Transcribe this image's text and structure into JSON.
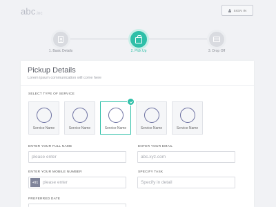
{
  "header": {
    "logo_main": "abc",
    "logo_suffix": ".inc",
    "signin_label": "SIGN IN"
  },
  "steps": [
    {
      "label": "1. Basic Details",
      "icon": "document-icon",
      "state": "inactive"
    },
    {
      "label": "2. Pick Up",
      "icon": "bag-icon",
      "state": "active"
    },
    {
      "label": "3. Drop Off",
      "icon": "box-icon",
      "state": "inactive"
    }
  ],
  "colors": {
    "accent": "#2ebfa8",
    "inactive_step": "#d9dbe0"
  },
  "form": {
    "title": "Pickup Details",
    "subtitle": "Lorem ipsum communication will come here",
    "service_section_label": "SELECT TYPE OF SERVICE",
    "services": [
      {
        "name": "Service Name",
        "selected": false
      },
      {
        "name": "Service Name",
        "selected": false
      },
      {
        "name": "Service Name",
        "selected": true
      },
      {
        "name": "Service Name",
        "selected": false
      },
      {
        "name": "Service Name",
        "selected": false
      }
    ],
    "full_name": {
      "label": "ENTER YOUR FULL NAME",
      "placeholder": "please enter"
    },
    "email": {
      "label": "ENTER YOUR EMAIL",
      "placeholder": "abc.xyz.com"
    },
    "mobile": {
      "label": "ENTER YOUR MOBILE NUMBER",
      "prefix": "+91",
      "placeholder": "please enter"
    },
    "task": {
      "label": "SPECIFY TASK",
      "placeholder": "Specify in detail"
    },
    "preferred_date": {
      "label": "PREFERRED DATE"
    }
  }
}
